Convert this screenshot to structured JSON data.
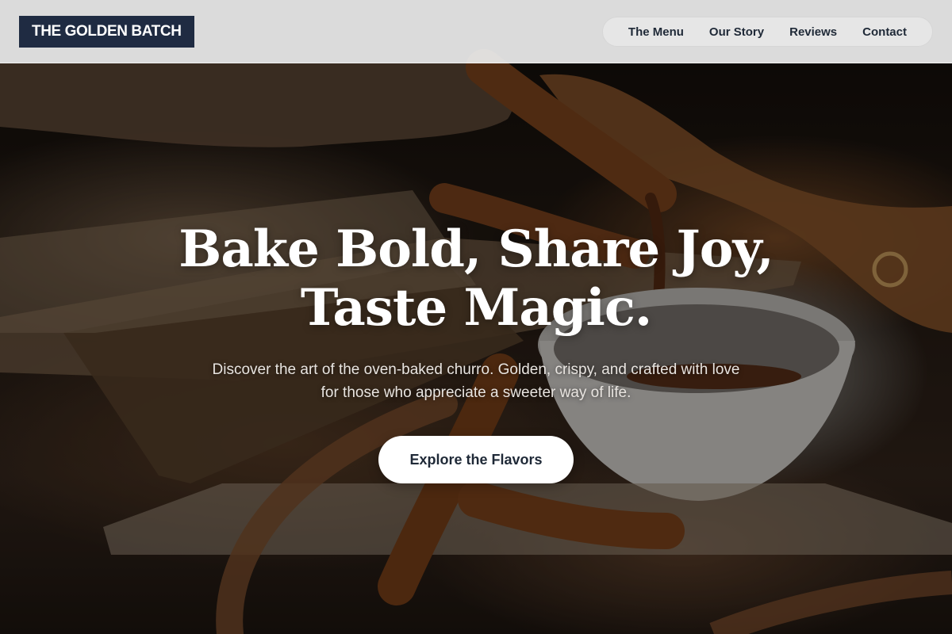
{
  "brand": {
    "name": "THE GOLDEN BATCH"
  },
  "nav": {
    "items": [
      {
        "label": "The Menu"
      },
      {
        "label": "Our Story"
      },
      {
        "label": "Reviews"
      },
      {
        "label": "Contact"
      }
    ]
  },
  "hero": {
    "headline": "Bake Bold, Share Joy, Taste Magic.",
    "subtitle": "Discover the art of the oven-baked churro. Golden, crispy, and crafted with love for those who appreciate a sweeter way of life.",
    "cta_label": "Explore the Flavors"
  },
  "colors": {
    "logo_bg": "#1f2b42",
    "nav_bg": "#ececec",
    "text_dark": "#1f2937",
    "cta_bg": "#ffffff"
  }
}
